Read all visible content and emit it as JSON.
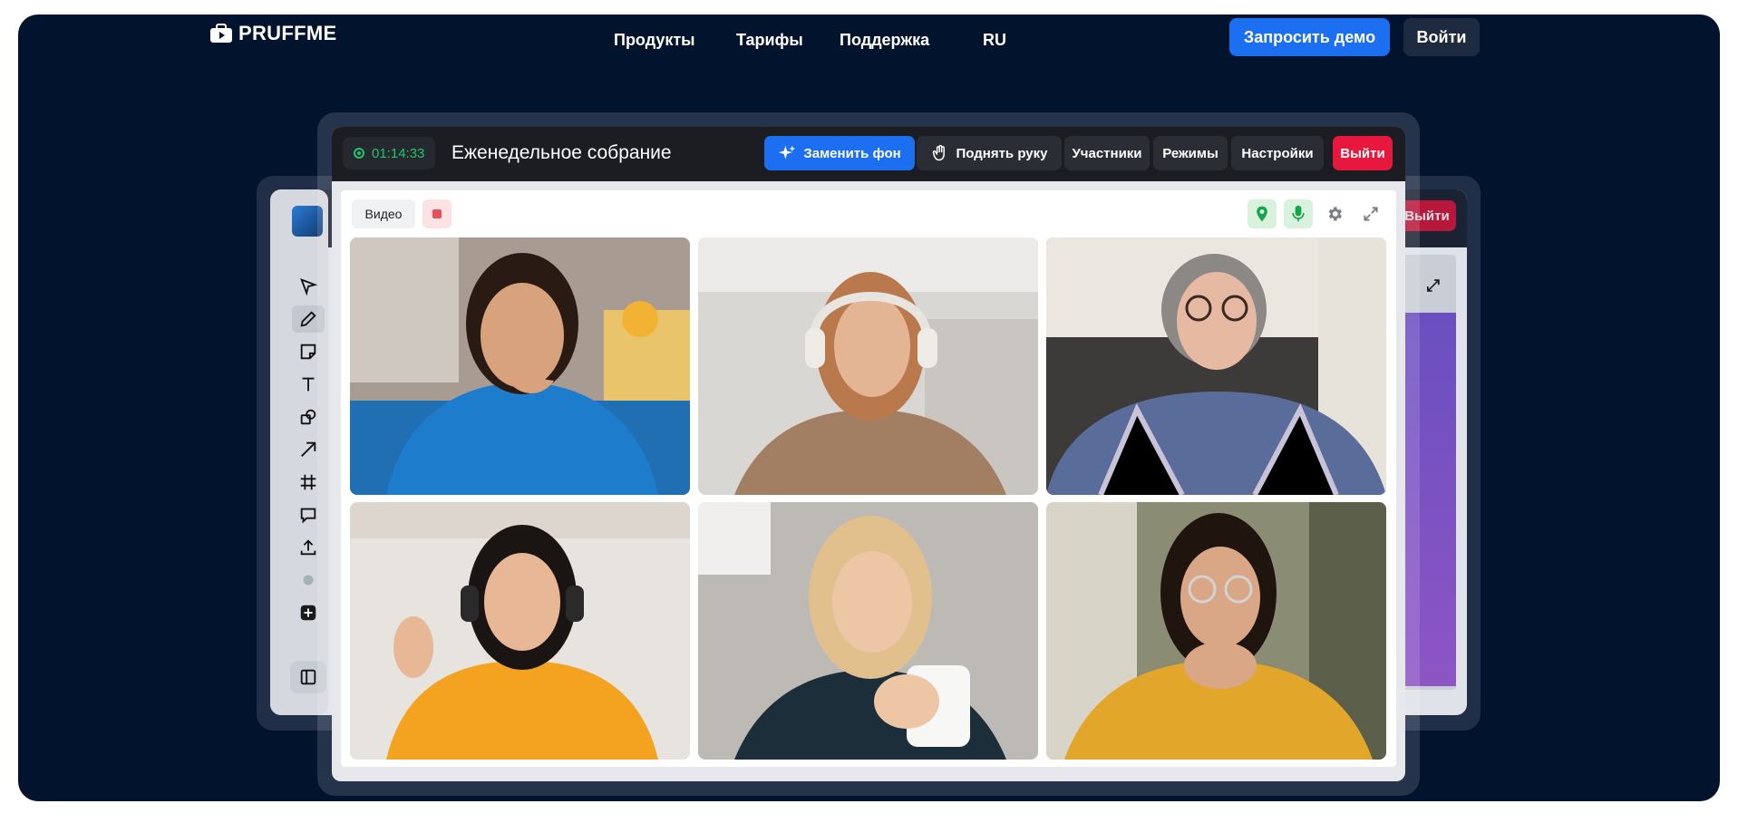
{
  "nav": {
    "logo": "PRUFFME",
    "links": [
      "Продукты",
      "Тарифы",
      "Поддержка",
      "RU"
    ],
    "demo_button": "Запросить демо",
    "login_button": "Войти"
  },
  "whiteboard": {
    "exit_label": "Выйти"
  },
  "meeting": {
    "timer": "01:14:33",
    "title": "Еженедельное собрание",
    "buttons": {
      "change_bg": "Заменить фон",
      "raise_hand": "Поднять руку",
      "participants": "Участники",
      "modes": "Режимы",
      "settings": "Настройки",
      "exit": "Выйти"
    },
    "video_tab": "Видео"
  },
  "colors": {
    "brand_bg": "#02132e",
    "accent_blue": "#1d6ff2",
    "exit_red": "#e8173d",
    "timer_green": "#20c46b"
  }
}
